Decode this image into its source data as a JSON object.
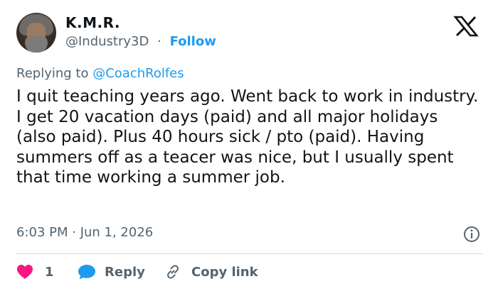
{
  "author": {
    "name": "K.M.R.",
    "handle": "@Industry3D",
    "separator": "·",
    "follow_label": "Follow"
  },
  "reply_context": {
    "prefix": "Replying to ",
    "mention": "@CoachRolfes"
  },
  "tweet": {
    "text": "I quit teaching years ago. Went back to work in industry. I get 20 vacation days (paid) and all major holidays (also paid). Plus 40 hours sick / pto (paid). Having summers off as a teacer was nice, but I usually spent that time working a summer job."
  },
  "meta": {
    "timestamp": "6:03 PM · Jun 1, 2026"
  },
  "actions": {
    "like_count": "1",
    "reply_label": "Reply",
    "copy_link_label": "Copy link"
  },
  "icons": {
    "logo": "x-logo-icon",
    "info": "info-icon",
    "like": "heart-icon",
    "reply": "speech-bubble-icon",
    "copy_link": "link-icon"
  },
  "colors": {
    "link_blue": "#1d9bf0",
    "secondary_text": "#536471",
    "like_pink": "#f91880"
  }
}
